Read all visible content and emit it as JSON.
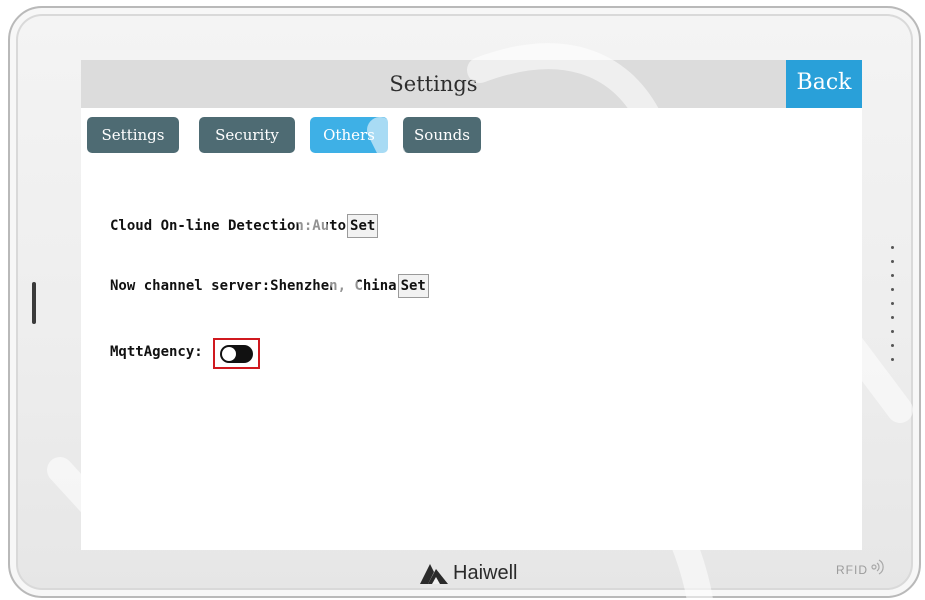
{
  "header": {
    "title": "Settings",
    "back_label": "Back"
  },
  "tabs": [
    {
      "label": "Settings",
      "active": false
    },
    {
      "label": "Security",
      "active": false
    },
    {
      "label": "Others",
      "active": true
    },
    {
      "label": "Sounds",
      "active": false
    }
  ],
  "settings": {
    "cloud_detection_label": "Cloud On-line Detection:Auto",
    "cloud_detection_set": "Set",
    "channel_server_label": "Now channel server:Shenzhen, China",
    "channel_server_set": "Set",
    "mqtt_label": "MqttAgency:",
    "mqtt_enabled": false
  },
  "device": {
    "brand": "Haiwell",
    "rfid_label": "RFID",
    "logo_icon": "haiwell-logo-icon",
    "rfid_icon": "rfid-wave-icon"
  },
  "watermark": {
    "text": "Haiwell"
  },
  "colors": {
    "title_bar": "#dcdcdc",
    "back_button": "#29a0d9",
    "tab_inactive": "#4e6b73",
    "tab_active": "#3eb0e6",
    "highlight_border": "#d0191f"
  }
}
